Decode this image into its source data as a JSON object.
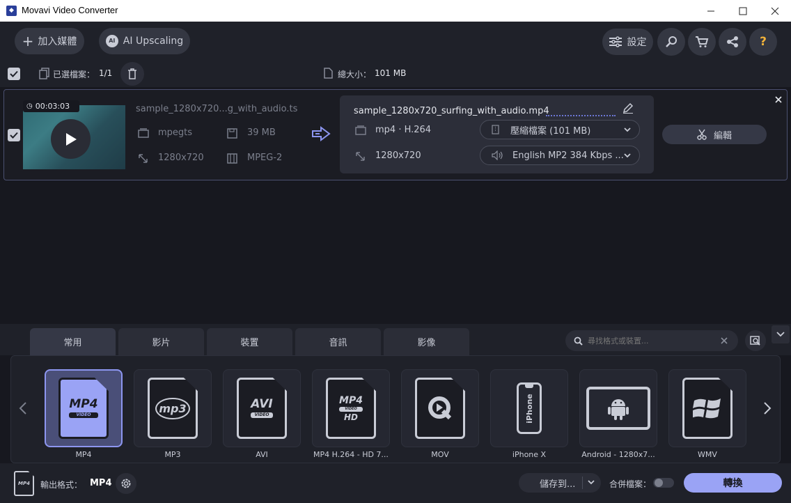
{
  "window": {
    "title": "Movavi Video Converter"
  },
  "toolbar": {
    "add_media": "加入媒體",
    "ai_upscaling": "AI Upscaling",
    "settings": "設定",
    "help": "?"
  },
  "selection": {
    "selected_label": "已選檔案：",
    "selected_count": "1/1",
    "total_size_label": "總大小：",
    "total_size": "101 MB"
  },
  "file": {
    "duration": "00:03:03",
    "source_name": "sample_1280x720...g_with_audio.ts",
    "source_container": "mpegts",
    "source_size": "39 MB",
    "source_resolution": "1280x720",
    "source_codec": "MPEG-2",
    "output_name": "sample_1280x720_surfing_with_audio.mp4",
    "output_format": "mp4 · H.264",
    "output_resolution": "1280x720",
    "compress_option": "壓縮檔案 (101 MB)",
    "audio_option": "English MP2 384 Kbps ...",
    "edit_label": "編輯"
  },
  "tabs": [
    "常用",
    "影片",
    "裝置",
    "音訊",
    "影像"
  ],
  "search": {
    "placeholder": "尋找格式或裝置..."
  },
  "formats": [
    {
      "label": "MP4",
      "badge": "MP4",
      "sub": "VIDEO"
    },
    {
      "label": "MP3",
      "badge": "mp3",
      "sub": ""
    },
    {
      "label": "AVI",
      "badge": "AVI",
      "sub": "VIDEO"
    },
    {
      "label": "MP4 H.264 - HD 7...",
      "badge": "MP4",
      "sub": "HD"
    },
    {
      "label": "MOV",
      "badge": "Q",
      "sub": ""
    },
    {
      "label": "iPhone X",
      "badge": "iPhone",
      "sub": ""
    },
    {
      "label": "Android - 1280x7...",
      "badge": "android",
      "sub": ""
    },
    {
      "label": "WMV",
      "badge": "win",
      "sub": ""
    }
  ],
  "bottom": {
    "output_format_label": "輸出格式：",
    "output_format_value": "MP4",
    "save_to": "儲存到...",
    "merge_files": "合併檔案：",
    "convert": "轉換",
    "file_badge": "MP4"
  },
  "colors": {
    "accent": "#8d96f0",
    "convert_button": "#9aa3f5",
    "link_dots": "#6d78d6"
  }
}
